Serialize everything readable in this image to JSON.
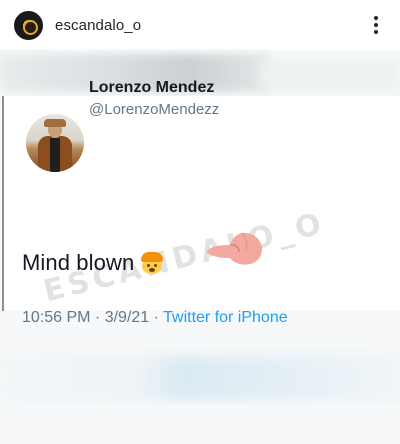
{
  "post": {
    "username": "escandalo_o",
    "more_icon": "more-vertical-icon"
  },
  "tweet": {
    "author_name": "Lorenzo Mendez",
    "author_handle": "@LorenzoMendezz",
    "text": "Mind blown",
    "emoji": "exploding-head-emoji",
    "pointer": "pointing-left-hand-emoji",
    "time": "10:56 PM · 3/9/21 · ",
    "source": "Twitter for iPhone",
    "watermark": "ESCANDALO_O"
  },
  "colors": {
    "handle": "#657786",
    "link": "#1da1f2",
    "text": "#141823",
    "background": "#f6f8f9"
  }
}
